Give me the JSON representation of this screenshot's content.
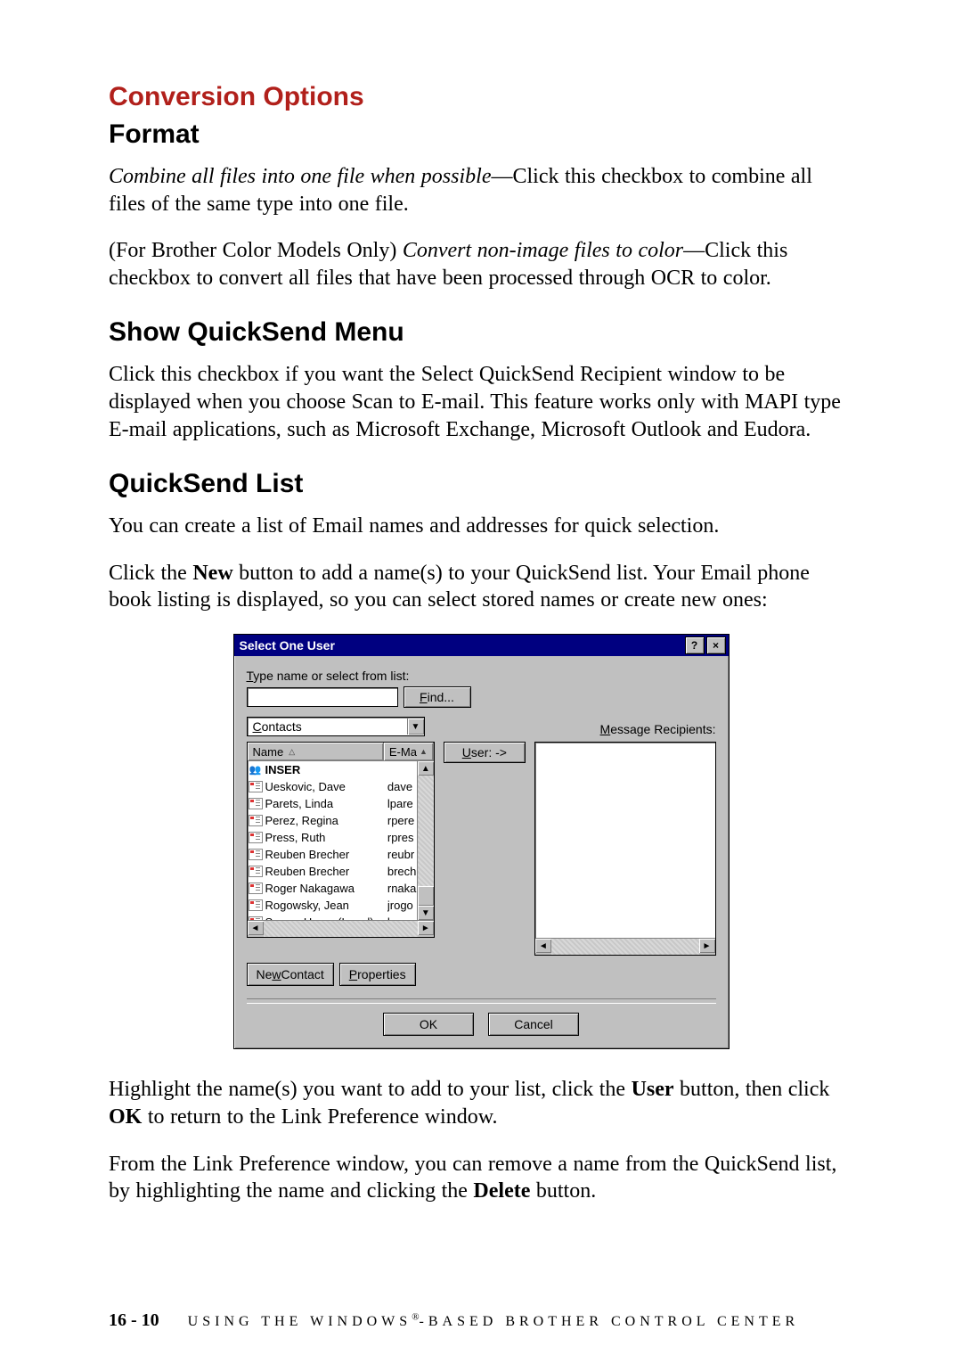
{
  "headings": {
    "h1a": "Conversion Options",
    "h1b": "Format",
    "h2": "Show QuickSend Menu",
    "h3": "QuickSend List"
  },
  "para": {
    "p1_em": "Combine all files into one file when possible",
    "p1_rest": "—Click this checkbox to combine all files of the same type into one file.",
    "p2_prefix": "(For Brother Color Models Only) ",
    "p2_em": "Convert non-image files to color",
    "p2_rest": "—Click this checkbox to convert all files that have been processed through OCR to color.",
    "p3": "Click this checkbox if you want the Select QuickSend Recipient window to be displayed when you choose Scan to E-mail. This feature works only with MAPI type E-mail applications, such as Microsoft Exchange, Microsoft Outlook and Eudora.",
    "p4": "You can create a list of Email names and addresses for quick selection.",
    "p5_a": "Click the ",
    "p5_b": "New",
    "p5_c": " button to add a name(s) to your QuickSend list. Your Email phone book listing is displayed, so you can select stored names or create new ones:",
    "p6_a": "Highlight the name(s) you want to add to your list, click the ",
    "p6_b": "User",
    "p6_c": " button, then click ",
    "p6_d": "OK",
    "p6_e": " to return to the Link Preference window.",
    "p7_a": "From the Link Preference window, you can remove a name from the QuickSend list, by highlighting the name and clicking the ",
    "p7_b": "Delete",
    "p7_c": " button."
  },
  "dialog": {
    "title": "Select One User",
    "help_btn": "?",
    "close_btn": "×",
    "type_label_u": "T",
    "type_label_rest": "ype name or select from list:",
    "find_u": "F",
    "find_rest": "ind...",
    "contacts_u": "C",
    "contacts_rest": "ontacts",
    "recipients_u": "M",
    "recipients_rest": "essage Recipients:",
    "col_name": "Name",
    "col_email_short": "E-Ma",
    "user_btn": "U",
    "user_btn_rest": "ser: ->",
    "newcontact_a": "Ne",
    "newcontact_u": "w",
    "newcontact_b": " Contact",
    "properties_u": "P",
    "properties_rest": "roperties",
    "ok": "OK",
    "cancel": "Cancel",
    "rows": [
      {
        "type": "group",
        "name": "INSER",
        "email": ""
      },
      {
        "type": "card",
        "name": "Ueskovic, Dave",
        "email": "dave"
      },
      {
        "type": "card",
        "name": "Parets, Linda",
        "email": "lpare"
      },
      {
        "type": "card",
        "name": "Perez, Regina",
        "email": "rpere"
      },
      {
        "type": "card",
        "name": "Press, Ruth",
        "email": "rpres"
      },
      {
        "type": "card",
        "name": "Reuben Brecher",
        "email": "reubr"
      },
      {
        "type": "card",
        "name": "Reuben Brecher",
        "email": "brech"
      },
      {
        "type": "card",
        "name": "Roger Nakagawa",
        "email": "rnaka"
      },
      {
        "type": "card",
        "name": "Rogowsky, Jean",
        "email": "jrogo"
      },
      {
        "type": "card",
        "name": "Sacco, Henry (Legal)",
        "email": "hsac"
      }
    ]
  },
  "footer": {
    "pageno": "16 - 10",
    "title_a": "USING THE WINDOWS",
    "reg": "®",
    "title_b": "-BASED BROTHER CONTROL CENTER"
  }
}
